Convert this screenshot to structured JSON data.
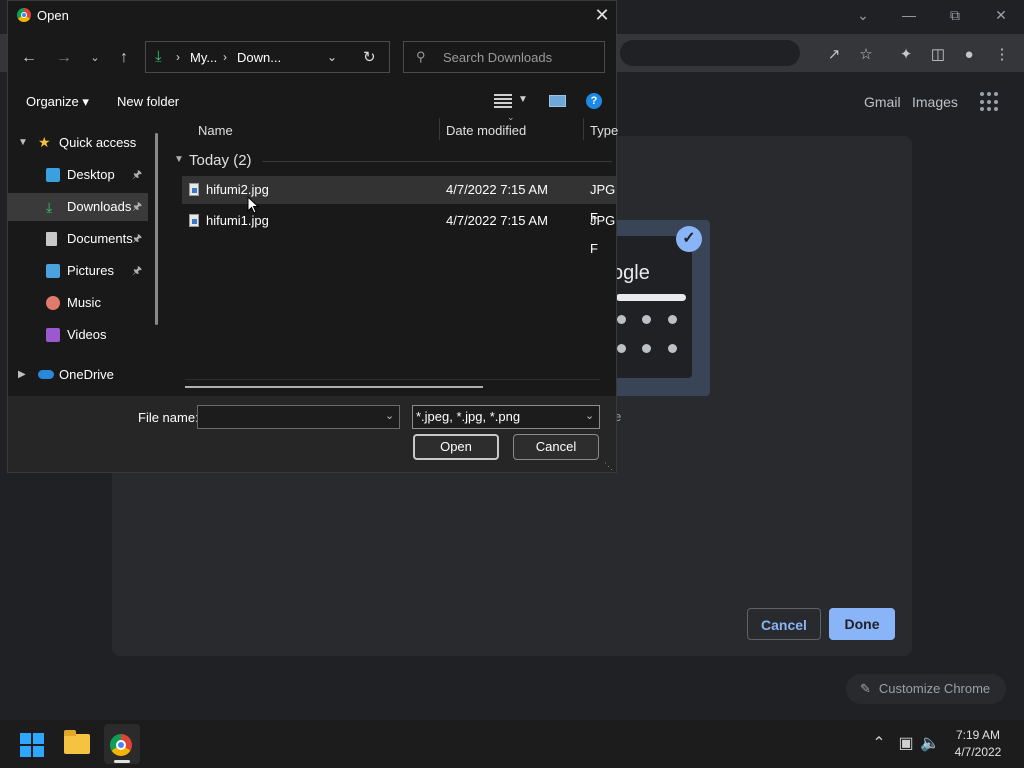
{
  "chrome": {
    "links": {
      "gmail": "Gmail",
      "images": "Images"
    },
    "tile_word": "ogle",
    "tile_caption_tail": "e",
    "customize_label": "Customize Chrome",
    "cancel_label": "Cancel",
    "done_label": "Done",
    "accent": "#8ab4f8"
  },
  "dialog": {
    "title": "Open",
    "address": {
      "segments": [
        "My...",
        "Down..."
      ]
    },
    "search_placeholder": "Search Downloads",
    "commands": {
      "organize": "Organize ▾",
      "new_folder": "New folder"
    },
    "nav": {
      "quick_access": "Quick access",
      "items": [
        {
          "label": "Desktop",
          "icon": "desktop-icon",
          "pinned": true
        },
        {
          "label": "Downloads",
          "icon": "download-icon",
          "pinned": true,
          "selected": true
        },
        {
          "label": "Documents",
          "icon": "documents-icon",
          "pinned": true
        },
        {
          "label": "Pictures",
          "icon": "pictures-icon",
          "pinned": true
        },
        {
          "label": "Music",
          "icon": "music-icon",
          "pinned": false
        },
        {
          "label": "Videos",
          "icon": "videos-icon",
          "pinned": false
        }
      ],
      "onedrive": "OneDrive"
    },
    "columns": {
      "name": "Name",
      "date": "Date modified",
      "type": "Type"
    },
    "group": "Today (2)",
    "files": [
      {
        "name": "hifumi2.jpg",
        "date": "4/7/2022 7:15 AM",
        "type": "JPG F",
        "selected": true
      },
      {
        "name": "hifumi1.jpg",
        "date": "4/7/2022 7:15 AM",
        "type": "JPG F",
        "selected": false
      }
    ],
    "filename_label": "File name:",
    "filename_value": "",
    "filter": "*.jpeg, *.jpg, *.png",
    "open_label": "Open",
    "cancel_label": "Cancel"
  },
  "taskbar": {
    "time": "7:19 AM",
    "date": "4/7/2022"
  }
}
